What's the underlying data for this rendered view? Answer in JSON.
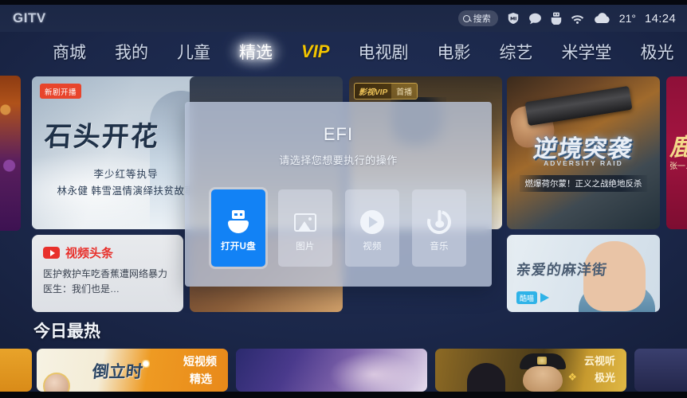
{
  "statusbar": {
    "logo": "GITV",
    "search_label": "搜索",
    "search_icon": "magnifier-icon",
    "icons": [
      "mi-shield-icon",
      "chat-bubble-icon",
      "usb-drive-icon",
      "wifi-icon",
      "cloud-icon"
    ],
    "temperature": "21°",
    "clock": "14:24"
  },
  "nav": {
    "items": [
      {
        "label": "商城",
        "active": false
      },
      {
        "label": "我的",
        "active": false
      },
      {
        "label": "儿童",
        "active": false
      },
      {
        "label": "精选",
        "active": true
      },
      {
        "label": "VIP",
        "active": false,
        "style": "vip"
      },
      {
        "label": "电视剧",
        "active": false
      },
      {
        "label": "电影",
        "active": false
      },
      {
        "label": "综艺",
        "active": false
      },
      {
        "label": "米学堂",
        "active": false
      },
      {
        "label": "极光",
        "active": false
      }
    ]
  },
  "hero": {
    "badge": "新剧开播",
    "title": "石头开花",
    "sub1": "李少红等执导",
    "sub2": "林永健 韩雪温情演绎扶贫故事"
  },
  "news": {
    "icon": "play-badge-icon",
    "title": "视频头条",
    "body": "医护救护车吃香蕉遭网络暴力 医生：我们也是…"
  },
  "vip_card": {
    "badge_main": "影视VIP",
    "badge_sub": "首播"
  },
  "action_card": {
    "title": "逆境突袭",
    "title_en": "ADVERSITY RAID",
    "tagline": "燃爆荷尔蒙！正义之战绝地反杀"
  },
  "edge_right_card": {
    "title": "鹿",
    "sub": "张一…"
  },
  "girl_card": {
    "title": "亲爱的麻洋街",
    "brand": "酷喵"
  },
  "section": {
    "title": "今日最热"
  },
  "row2": {
    "card_short": {
      "title": "倒立时",
      "tag_line1": "短视频",
      "tag_line2": "精选"
    },
    "card_gold": {
      "line1": "云视听",
      "line2": "极光"
    }
  },
  "dialog": {
    "title": "EFI",
    "subtitle": "请选择您想要执行的操作",
    "accent_color": "#1282f5",
    "tiles": [
      {
        "label": "打开U盘",
        "icon": "usb-drive-icon",
        "selected": true
      },
      {
        "label": "图片",
        "icon": "picture-icon",
        "selected": false
      },
      {
        "label": "视频",
        "icon": "play-circle-icon",
        "selected": false
      },
      {
        "label": "音乐",
        "icon": "music-note-icon",
        "selected": false
      }
    ]
  }
}
